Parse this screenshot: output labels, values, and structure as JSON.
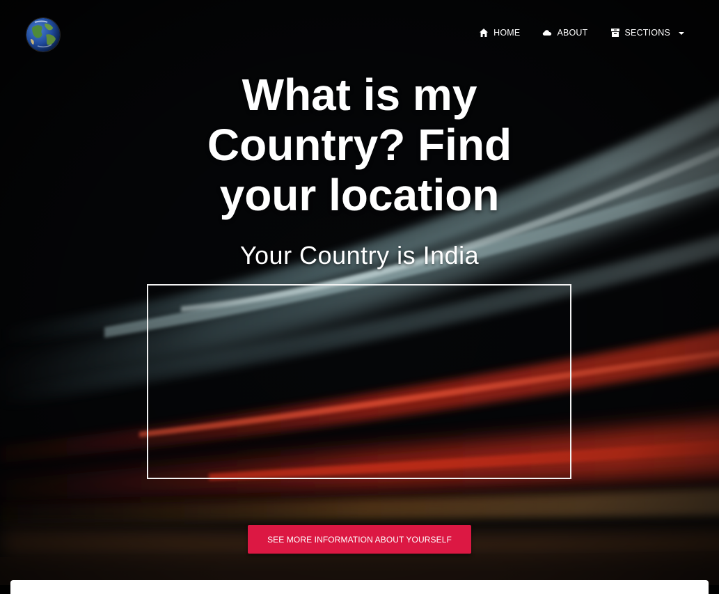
{
  "nav": {
    "home_label": "HOME",
    "about_label": "ABOUT",
    "sections_label": "SECTIONS"
  },
  "hero": {
    "title_lines": [
      "What is my",
      "Country? Find",
      "your location"
    ],
    "subtitle": "Your Country is India"
  },
  "cta": {
    "label": "SEE MORE INFORMATION ABOUT YOURSELF"
  },
  "colors": {
    "accent": "#dc1843",
    "text": "#ffffff",
    "background": "#030305"
  },
  "icons": {
    "logo": "globe-icon",
    "home": "home-icon",
    "about": "cloud-icon",
    "sections": "archive-icon",
    "dropdown": "caret-down-icon"
  }
}
